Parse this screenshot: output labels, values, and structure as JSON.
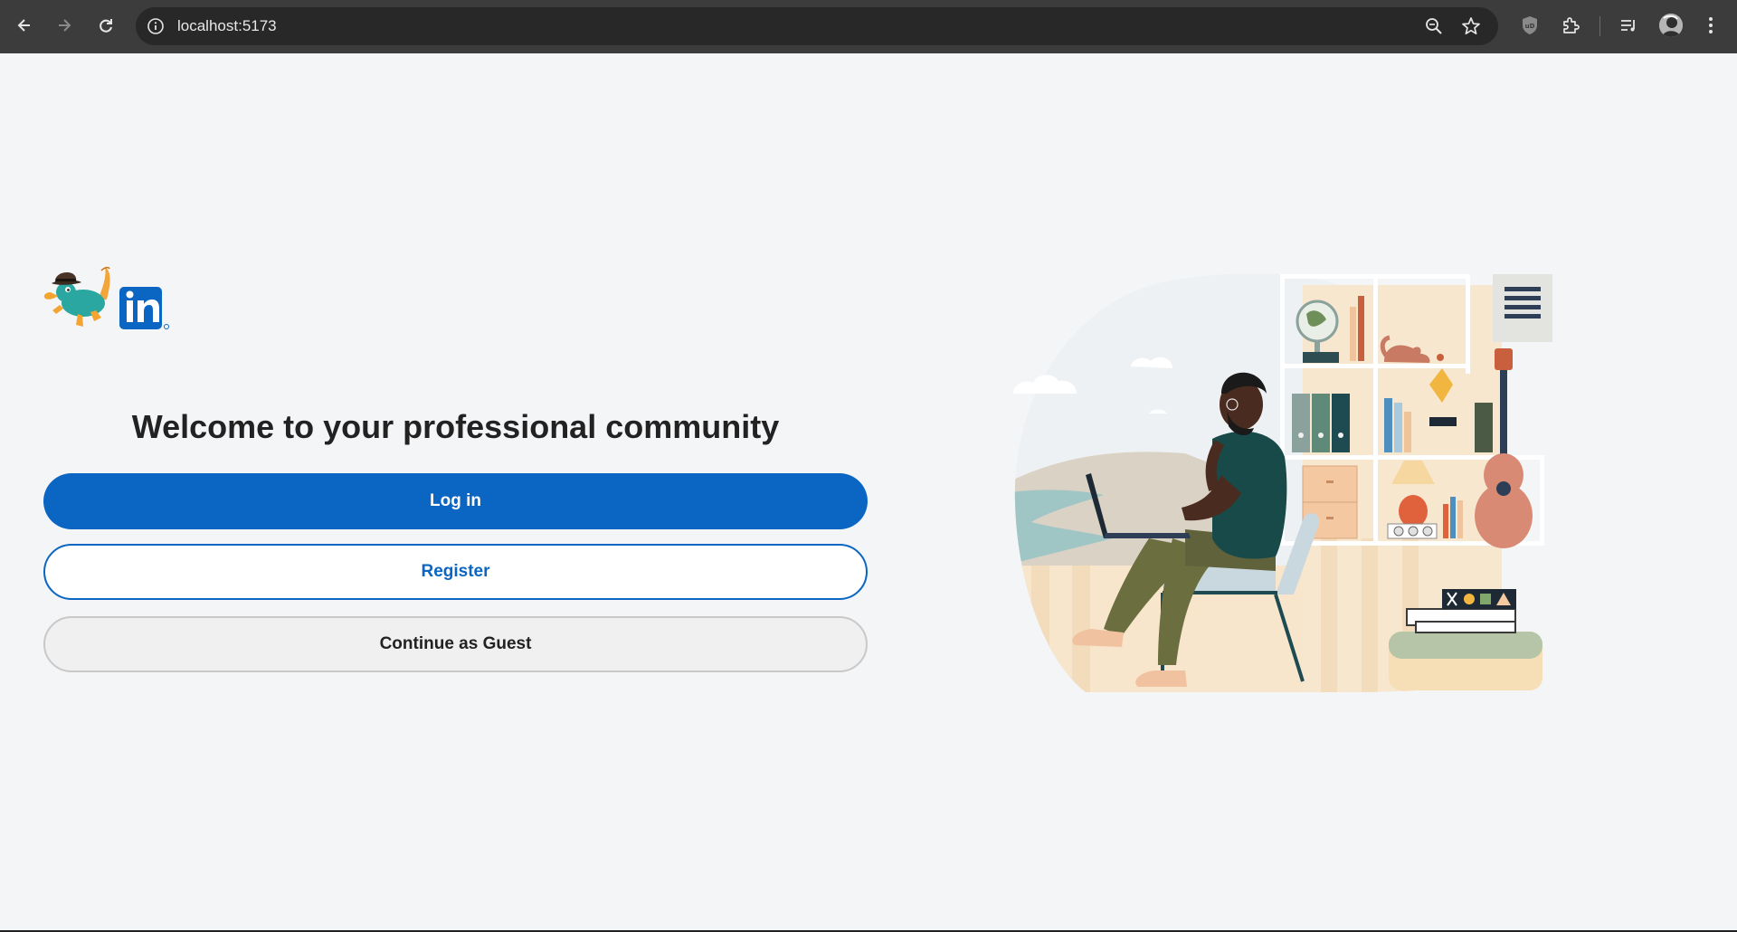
{
  "browser": {
    "url": "localhost:5173",
    "icons": [
      "back-arrow-icon",
      "forward-arrow-icon",
      "reload-icon",
      "info-icon",
      "zoom-icon",
      "star-icon",
      "shield-extension-icon",
      "puzzle-extension-icon",
      "media-control-icon",
      "profile-avatar",
      "kebab-menu-icon"
    ]
  },
  "main": {
    "welcome": "Welcome to your professional community",
    "login_label": "Log in",
    "register_label": "Register",
    "guest_label": "Continue as Guest"
  },
  "colors": {
    "primary": "#0a66c2",
    "page_background": "#f4f5f7",
    "chrome_background": "#3c3c3c"
  }
}
